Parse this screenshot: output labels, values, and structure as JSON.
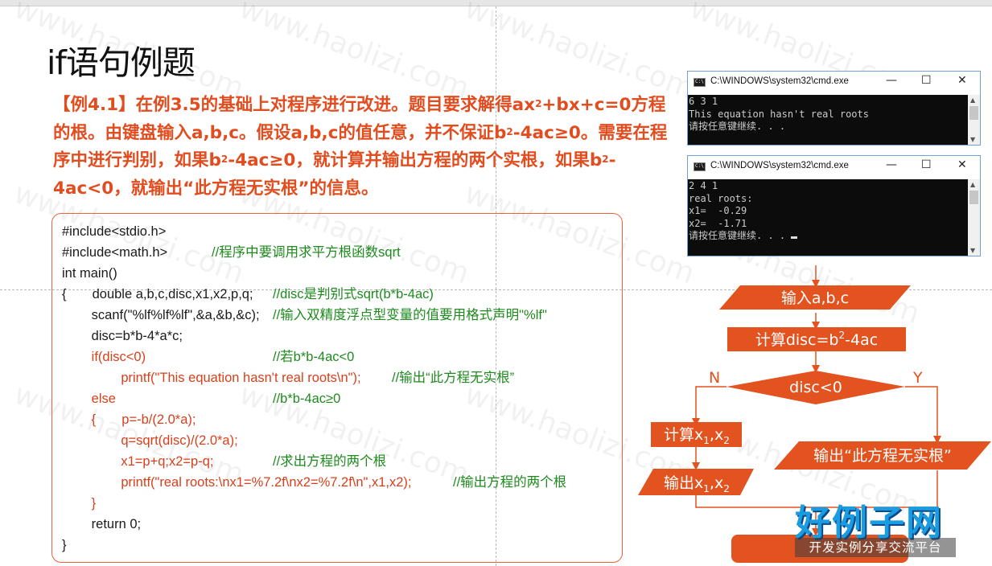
{
  "slide": {
    "title": "if语句例题",
    "intro_parts": [
      "【例4.1】在例3.5的基础上对程序进行改进。题目要求解得ax",
      "2",
      "+bx+c=0方程的根。由键盘输入a,b,c。假设a,b,c的值任意，并不保证b",
      "2",
      "-4ac≥0。需要在程序中进行判别，如果b",
      "2",
      "-4ac≥0，就计算并输出方程的两个实根，如果b",
      "2",
      "-4ac<0，就输出“此方程无实根”的信息。"
    ]
  },
  "code": {
    "lines": [
      {
        "code": "#include<stdio.h>",
        "comment": ""
      },
      {
        "code": "#include<math.h>",
        "comment": "//程序中要调用求平方根函数sqrt"
      },
      {
        "code": "int main()",
        "comment": ""
      },
      {
        "code": "{       double a,b,c,disc,x1,x2,p,q;",
        "comment": "//disc是判别式sqrt(b*b-4ac)"
      },
      {
        "code": "        scanf(\"%lf%lf%lf\",&a,&b,&c);",
        "comment": "//输入双精度浮点型变量的值要用格式声明\"%lf\""
      },
      {
        "code": "        disc=b*b-4*a*c;",
        "comment": ""
      },
      {
        "code": "        if(disc<0)",
        "comment": "//若b*b-4ac<0"
      },
      {
        "code": "                printf(\"This equation hasn't real roots\\n\");",
        "comment": "//输出“此方程无实根”"
      },
      {
        "code": "        else",
        "comment": "//b*b-4ac≥0"
      },
      {
        "code": "        {       p=-b/(2.0*a);",
        "comment": ""
      },
      {
        "code": "                q=sqrt(disc)/(2.0*a);",
        "comment": ""
      },
      {
        "code": "                x1=p+q;x2=p-q;",
        "comment": "//求出方程的两个根"
      },
      {
        "code": "                printf(\"real roots:\\nx1=%7.2f\\nx2=%7.2f\\n\",x1,x2);",
        "comment": "//输出方程的两个根"
      },
      {
        "code": "        }",
        "comment": ""
      },
      {
        "code": "        return 0;",
        "comment": ""
      },
      {
        "code": "}",
        "comment": ""
      }
    ]
  },
  "console1": {
    "title": "C:\\WINDOWS\\system32\\cmd.exe",
    "lines": [
      "6 3 1",
      "This equation hasn't real roots",
      "请按任意键继续. . ."
    ]
  },
  "console2": {
    "title": "C:\\WINDOWS\\system32\\cmd.exe",
    "lines": [
      "2 4 1",
      "real roots:",
      "x1=  -0.29",
      "x2=  -1.71",
      "请按任意键继续. . . "
    ]
  },
  "window_buttons": {
    "minimize": "—",
    "maximize": "☐",
    "close": "✕"
  },
  "flowchart": {
    "input": "输入a,b,c",
    "compute_disc": "计算disc=b",
    "compute_disc_sup": "2",
    "compute_disc_tail": "-4ac",
    "decision": "disc<0",
    "no_label": "N",
    "yes_label": "Y",
    "compute_roots": "计算x",
    "output_roots": "输出x",
    "sub1": "1",
    "sub2": "2",
    "comma": ",",
    "output_no_roots": "输出“此方程无实根”"
  },
  "logo": {
    "title": "好例子网",
    "subtitle": "开发实例分享交流平台"
  },
  "watermark": "www.haolizi.com",
  "colors": {
    "accent": "#e2531f",
    "comment": "#1e8a1e",
    "keyword": "#d7401b"
  }
}
